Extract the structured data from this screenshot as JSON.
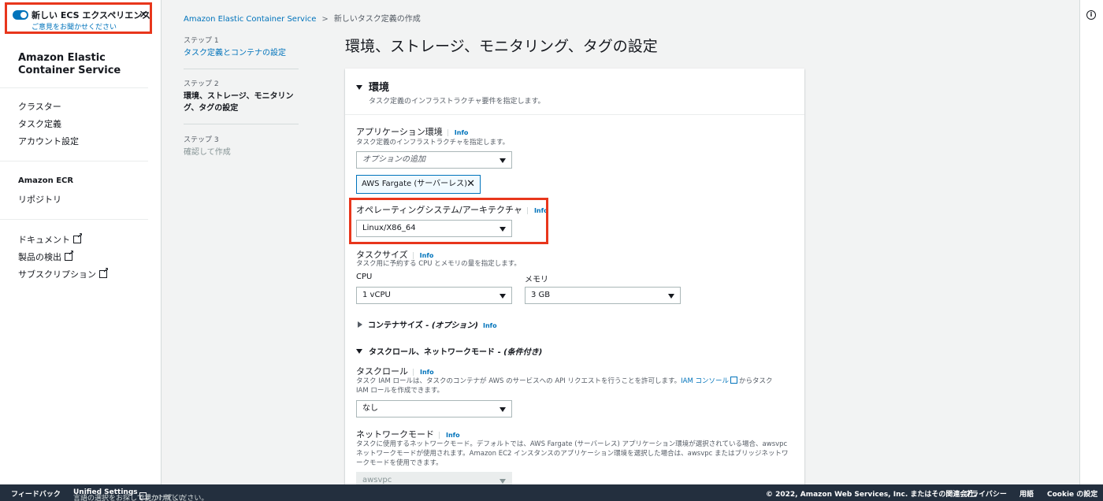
{
  "sidebar": {
    "new_experience": {
      "title": "新しい ECS エクスペリエンス",
      "link": "ご意見をお聞かせください",
      "close_icon": "close-icon"
    },
    "brand": "Amazon Elastic Container Service",
    "nav_ecs": [
      "クラスター",
      "タスク定義",
      "アカウント設定"
    ],
    "ecr_heading": "Amazon ECR",
    "nav_ecr": [
      "リポジトリ"
    ],
    "nav_ext": [
      "ドキュメント",
      "製品の検出",
      "サブスクリプション"
    ]
  },
  "breadcrumb": {
    "root": "Amazon Elastic Container Service",
    "current": "新しいタスク定義の作成"
  },
  "steps": [
    {
      "label": "ステップ 1",
      "name": "タスク定義とコンテナの設定"
    },
    {
      "label": "ステップ 2",
      "name": "環境、ストレージ、モニタリング、タグの設定"
    },
    {
      "label": "ステップ 3",
      "name": "確認して作成"
    }
  ],
  "page_title": "環境、ストレージ、モニタリング、タグの設定",
  "info_label": "Info",
  "environment": {
    "title": "環境",
    "description": "タスク定義のインフラストラクチャ要件を指定します。",
    "app_env": {
      "label": "アプリケーション環境",
      "description": "タスク定義のインフラストラクチャを指定します。",
      "placeholder": "オプションの追加",
      "token": "AWS Fargate (サーバーレス)"
    },
    "os_arch": {
      "label": "オペレーティングシステム/アーキテクチャ",
      "value": "Linux/X86_64"
    },
    "task_size": {
      "label": "タスクサイズ",
      "description": "タスク用に予約する CPU とメモリの量を指定します。",
      "cpu_label": "CPU",
      "cpu_value": "1 vCPU",
      "memory_label": "メモリ",
      "memory_value": "3 GB"
    },
    "container_size": {
      "label": "コンテナサイズ - ",
      "optional": "(オプション)"
    },
    "task_role_network": {
      "label": "タスクロール、ネットワークモード - ",
      "conditional": "(条件付き)"
    },
    "task_role": {
      "label": "タスクロール",
      "desc_1": "タスク IAM ロールは、タスクのコンテナが AWS のサービスへの API リクエストを行うことを許可します。",
      "desc_link": "IAM コンソール",
      "desc_2": "からタスク IAM ロールを作成できます。",
      "value": "なし"
    },
    "network_mode": {
      "label": "ネットワークモード",
      "description": "タスクに使用するネットワークモード。デフォルトでは、AWS Fargate (サーバーレス) アプリケーション環境が選択されている場合、awsvpc ネットワークモードが使用されます。Amazon EC2 インスタンスのアプリケーション環境を選択した場合は、awsvpc またはブリッジネットワークモードを使用できます。",
      "value": "awsvpc"
    }
  },
  "footer": {
    "feedback": "フィードバック",
    "lang_1": "言語の選択をお探しですか? 新しい",
    "lang_bold": "Unified Settings",
    "lang_2": "で見つけてください。",
    "copyright": "© 2022, Amazon Web Services, Inc. またはその関連会社。",
    "privacy": "プライバシー",
    "terms": "用語",
    "cookie": "Cookie の設定"
  }
}
